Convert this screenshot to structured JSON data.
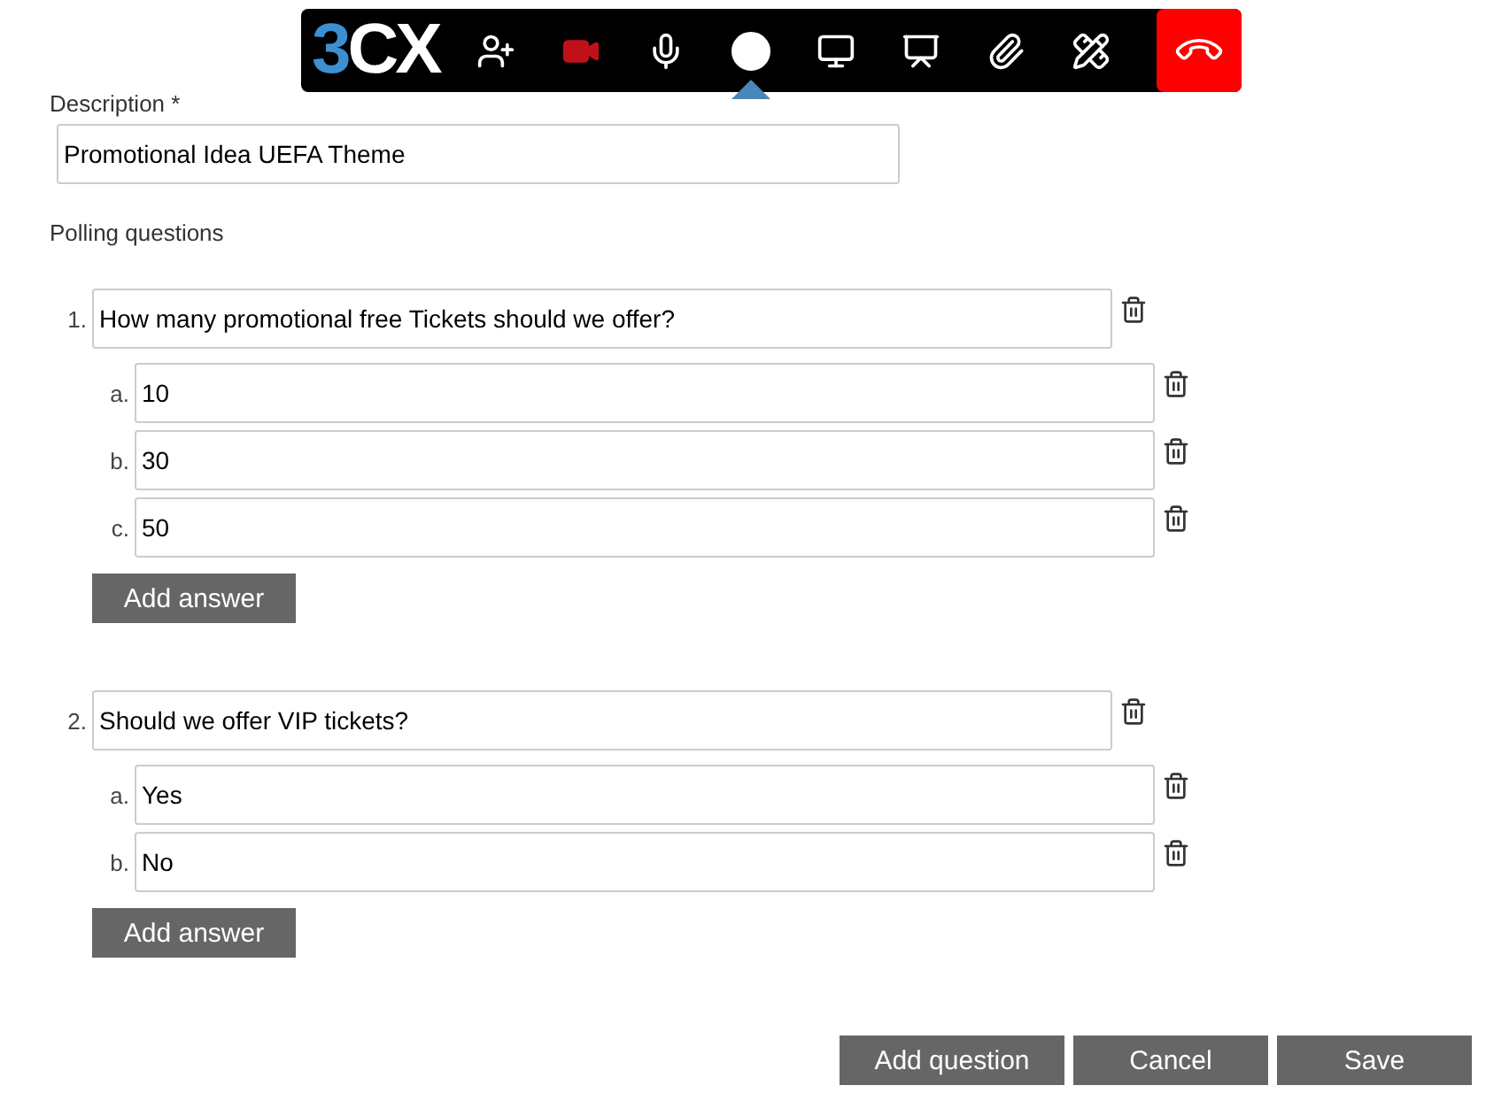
{
  "toolbar": {
    "logo": "3CX",
    "tools": [
      {
        "kind": "add-user",
        "selected": false
      },
      {
        "kind": "video",
        "selected": false,
        "color": "#c0111a"
      },
      {
        "kind": "mic",
        "selected": false
      },
      {
        "kind": "record",
        "selected": true
      },
      {
        "kind": "screen",
        "selected": false
      },
      {
        "kind": "presentation",
        "selected": false
      },
      {
        "kind": "attach",
        "selected": false
      },
      {
        "kind": "whiteboard",
        "selected": false
      },
      {
        "kind": "hangup",
        "selected": false
      }
    ]
  },
  "description": {
    "label": "Description *",
    "value": "Promotional Idea UEFA Theme"
  },
  "polling_label": "Polling questions",
  "questions": [
    {
      "number": "1.",
      "text": "How many promotional free Tickets should we offer?",
      "answers": [
        {
          "letter": "a.",
          "value": "10"
        },
        {
          "letter": "b.",
          "value": "30"
        },
        {
          "letter": "c.",
          "value": "50"
        }
      ],
      "add_answer": "Add answer"
    },
    {
      "number": "2.",
      "text": "Should we offer VIP tickets?",
      "answers": [
        {
          "letter": "a.",
          "value": "Yes"
        },
        {
          "letter": "b.",
          "value": "No"
        }
      ],
      "add_answer": "Add answer"
    }
  ],
  "buttons": [
    "Add question",
    "Cancel",
    "Save"
  ]
}
